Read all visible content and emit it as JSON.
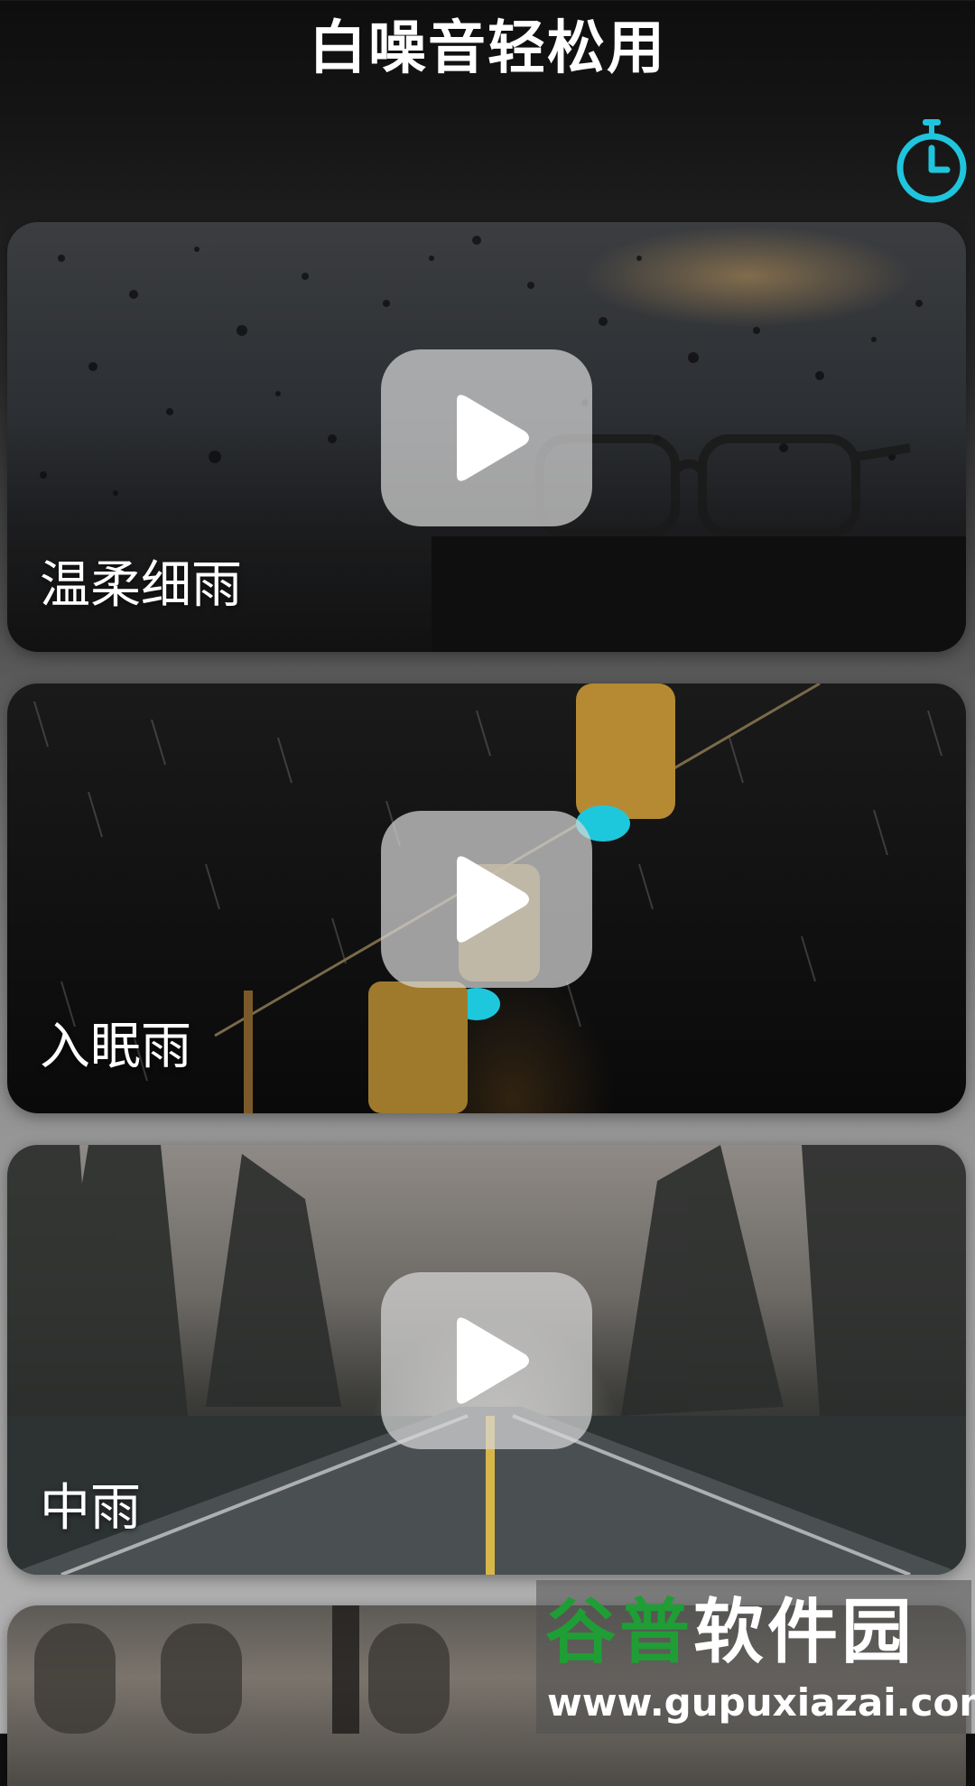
{
  "header": {
    "title": "白噪音轻松用",
    "timer_icon": "timer-icon",
    "accent_color": "#1fc5dc"
  },
  "cards": [
    {
      "label": "温柔细雨",
      "icon": "play-icon"
    },
    {
      "label": "入眠雨",
      "icon": "play-icon"
    },
    {
      "label": "中雨",
      "icon": "play-icon"
    },
    {
      "label": "",
      "icon": ""
    }
  ],
  "watermark": {
    "logo_green": "谷普",
    "logo_white": "软件园",
    "url": "www.gupuxiazai.com"
  }
}
